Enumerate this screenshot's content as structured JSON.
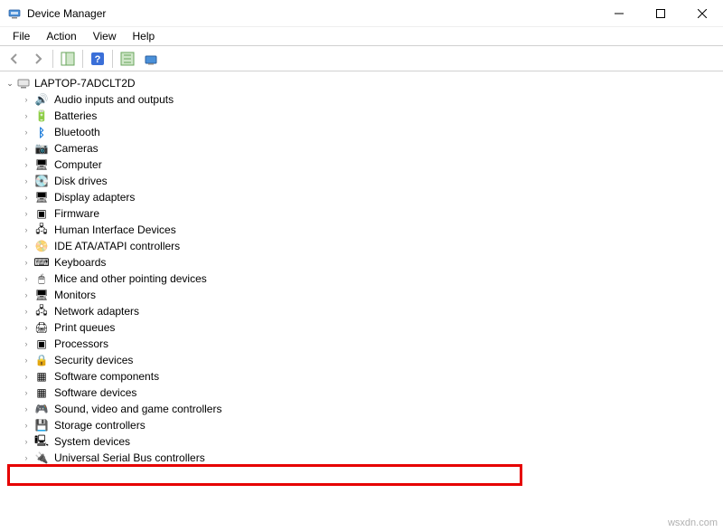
{
  "window": {
    "title": "Device Manager"
  },
  "menubar": {
    "file": "File",
    "action": "Action",
    "view": "View",
    "help": "Help"
  },
  "tree": {
    "root": "LAPTOP-7ADCLT2D",
    "items": [
      {
        "icon": "🔊",
        "label": "Audio inputs and outputs"
      },
      {
        "icon": "🔋",
        "label": "Batteries"
      },
      {
        "icon": "ᛒ",
        "label": "Bluetooth"
      },
      {
        "icon": "📷",
        "label": "Cameras"
      },
      {
        "icon": "🖥",
        "label": "Computer"
      },
      {
        "icon": "💽",
        "label": "Disk drives"
      },
      {
        "icon": "🖥",
        "label": "Display adapters"
      },
      {
        "icon": "▣",
        "label": "Firmware"
      },
      {
        "icon": "🖧",
        "label": "Human Interface Devices"
      },
      {
        "icon": "📀",
        "label": "IDE ATA/ATAPI controllers"
      },
      {
        "icon": "⌨",
        "label": "Keyboards"
      },
      {
        "icon": "🖱",
        "label": "Mice and other pointing devices"
      },
      {
        "icon": "🖥",
        "label": "Monitors"
      },
      {
        "icon": "🖧",
        "label": "Network adapters"
      },
      {
        "icon": "🖨",
        "label": "Print queues"
      },
      {
        "icon": "▣",
        "label": "Processors"
      },
      {
        "icon": "🔒",
        "label": "Security devices"
      },
      {
        "icon": "▦",
        "label": "Software components"
      },
      {
        "icon": "▦",
        "label": "Software devices"
      },
      {
        "icon": "🎮",
        "label": "Sound, video and game controllers"
      },
      {
        "icon": "💾",
        "label": "Storage controllers"
      },
      {
        "icon": "🖳",
        "label": "System devices"
      },
      {
        "icon": "🔌",
        "label": "Universal Serial Bus controllers"
      }
    ]
  },
  "highlight_index": 22,
  "watermark": "wsxdn.com"
}
